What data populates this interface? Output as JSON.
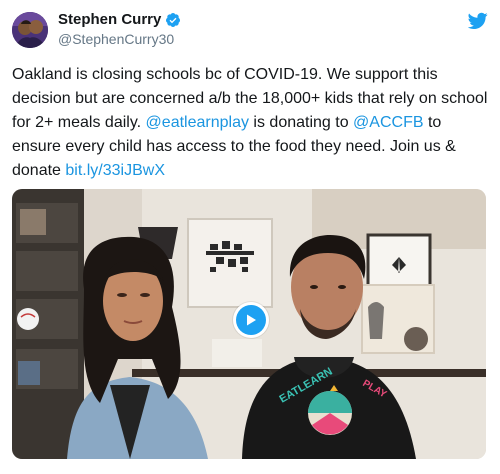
{
  "header": {
    "display_name": "Stephen Curry",
    "handle": "@StephenCurry30"
  },
  "tweet": {
    "text_1": "Oakland is closing schools bc of COVID-19. We support this decision but are concerned a/b the 18,000+ kids that rely on school for 2+ meals daily. ",
    "mention_1": "@eatlearnplay",
    "text_2": " is donating to ",
    "mention_2": "@ACCFB",
    "text_3": " to ensure every child has access to the food they need. Join us & donate ",
    "link": "bit.ly/33iJBwX"
  },
  "video": {
    "logo_text_left": "EATLEARN",
    "logo_text_right": "PLAY"
  },
  "colors": {
    "link": "#1b95e0",
    "verified": "#1da1f2",
    "twitter": "#1da1f2",
    "play": "#1da1f2"
  }
}
